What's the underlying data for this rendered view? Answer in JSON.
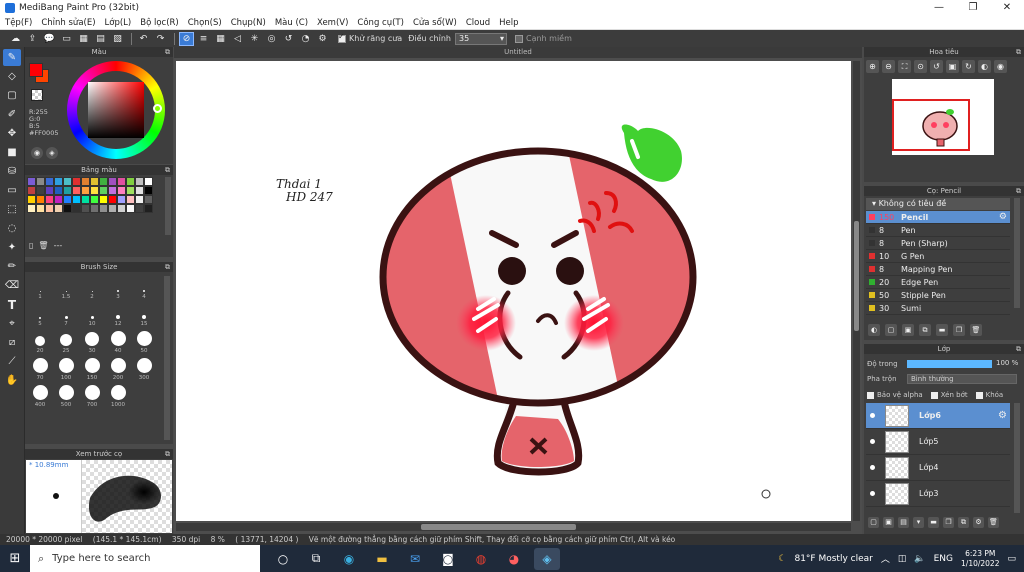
{
  "window": {
    "title": "MediBang Paint Pro (32bit)",
    "controls": [
      "—",
      "❐",
      "✕"
    ]
  },
  "menu": [
    "Tệp(F)",
    "Chỉnh sửa(E)",
    "Lớp(L)",
    "Bộ lọc(R)",
    "Chọn(S)",
    "Chụp(N)",
    "Màu (C)",
    "Xem(V)",
    "Công cụ(T)",
    "Cửa sổ(W)",
    "Cloud",
    "Help"
  ],
  "toolbar": {
    "antialias_label": "Khử răng cưa",
    "adjust_label": "Điều chỉnh",
    "adjust_value": "35",
    "edge_label": "Cạnh miềm"
  },
  "color_panel": {
    "title": "Màu",
    "r": "R:255",
    "g": "G:0",
    "b": "B:5",
    "hex": "#FF0005",
    "fg_color": "#FF0005"
  },
  "palette_panel": {
    "title": "Bảng màu",
    "more": "---",
    "colors": [
      "#7b5cd6",
      "#8a8a8a",
      "#3a6ad4",
      "#2fa0e0",
      "#4cc0c8",
      "#e03030",
      "#e08030",
      "#e0c030",
      "#40b040",
      "#a050c0",
      "#e050a0",
      "#80d040",
      "#c0c0c0",
      "#ffffff",
      "#c04040",
      "#404040",
      "#6040c0",
      "#2060c0",
      "#20a0a0",
      "#ff6060",
      "#ffa040",
      "#ffe040",
      "#60d060",
      "#c070e0",
      "#ff80c0",
      "#a0e060",
      "#e0e0e0",
      "#000000",
      "#ffd000",
      "#ff8000",
      "#ff4080",
      "#c020c0",
      "#2080ff",
      "#00c0ff",
      "#00e0a0",
      "#40ff40",
      "#ffff00",
      "#ff0000",
      "#a0a0ff",
      "#ffc0c0",
      "#f0f0f0",
      "#606060",
      "#fff0c0",
      "#ffe0a0",
      "#ffc0a0",
      "#f0d0b0",
      "#101010",
      "#303030",
      "#505050",
      "#707070",
      "#909090",
      "#b0b0b0",
      "#d0d0d0",
      "#f8f8f8",
      "#404040",
      "#202020"
    ]
  },
  "brush_size": {
    "title": "Brush Size",
    "sizes": [
      {
        "label": "1",
        "dot": 1
      },
      {
        "label": "1.5",
        "dot": 1
      },
      {
        "label": "2",
        "dot": 1
      },
      {
        "label": "3",
        "dot": 2
      },
      {
        "label": "4",
        "dot": 2
      },
      {
        "label": "5",
        "dot": 2
      },
      {
        "label": "7",
        "dot": 3
      },
      {
        "label": "10",
        "dot": 3
      },
      {
        "label": "12",
        "dot": 4
      },
      {
        "label": "15",
        "dot": 4
      },
      {
        "label": "20",
        "dot": 10
      },
      {
        "label": "25",
        "dot": 12
      },
      {
        "label": "30",
        "dot": 14
      },
      {
        "label": "40",
        "dot": 15
      },
      {
        "label": "50",
        "dot": 15
      },
      {
        "label": "70",
        "dot": 15
      },
      {
        "label": "100",
        "dot": 15
      },
      {
        "label": "150",
        "dot": 15
      },
      {
        "label": "200",
        "dot": 15
      },
      {
        "label": "300",
        "dot": 15
      },
      {
        "label": "400",
        "dot": 15
      },
      {
        "label": "500",
        "dot": 15
      },
      {
        "label": "700",
        "dot": 15
      },
      {
        "label": "1000",
        "dot": 15
      }
    ]
  },
  "preview_panel": {
    "title": "Xem trước cọ",
    "size": "* 10.89mm"
  },
  "canvas": {
    "doc_title": "Untitled",
    "handwriting_line1": "Thdai 1",
    "handwriting_line2": "HD 247"
  },
  "navigator": {
    "title": "Hoa tiêu"
  },
  "brushes": {
    "title": "Cọ: Pencil",
    "group": "Không có tiêu đề",
    "items": [
      {
        "size": "150",
        "name": "Pencil",
        "color": "#ff4060",
        "selected": true
      },
      {
        "size": "8",
        "name": "Pen",
        "color": "#333333",
        "selected": false
      },
      {
        "size": "8",
        "name": "Pen (Sharp)",
        "color": "#333333",
        "selected": false
      },
      {
        "size": "10",
        "name": "G Pen",
        "color": "#e03030",
        "selected": false
      },
      {
        "size": "8",
        "name": "Mapping Pen",
        "color": "#e03030",
        "selected": false
      },
      {
        "size": "20",
        "name": "Edge Pen",
        "color": "#30b030",
        "selected": false
      },
      {
        "size": "50",
        "name": "Stipple Pen",
        "color": "#e0c020",
        "selected": false
      },
      {
        "size": "30",
        "name": "Sumi",
        "color": "#e0c020",
        "selected": false
      }
    ]
  },
  "layers": {
    "title": "Lớp",
    "opacity_label": "Độ trong",
    "opacity_value": "100 %",
    "opacity_fraction": 1,
    "blend_label": "Pha trộn",
    "blend_value": "Bình thường",
    "protect_alpha": "Bảo vệ alpha",
    "clipping": "Xén bớt",
    "lock": "Khóa",
    "items": [
      {
        "name": "Lớp6",
        "selected": true
      },
      {
        "name": "Lớp5",
        "selected": false
      },
      {
        "name": "Lớp4",
        "selected": false
      },
      {
        "name": "Lớp3",
        "selected": false
      }
    ]
  },
  "status": {
    "dimensions": "20000 * 20000 pixel",
    "physical": "(145.1 * 145.1cm)",
    "dpi": "350 dpi",
    "zoom": "8 %",
    "coords": "( 13771, 14204 )",
    "hint": "Vẽ một đường thẳng bằng cách giữ phím Shift, Thay đổi cỡ cọ bằng cách giữ phím Ctrl, Alt và kéo"
  },
  "taskbar": {
    "search_placeholder": "Type here to search",
    "weather": "81°F  Mostly clear",
    "lang": "ENG",
    "time": "6:23 PM",
    "date": "1/10/2022"
  }
}
